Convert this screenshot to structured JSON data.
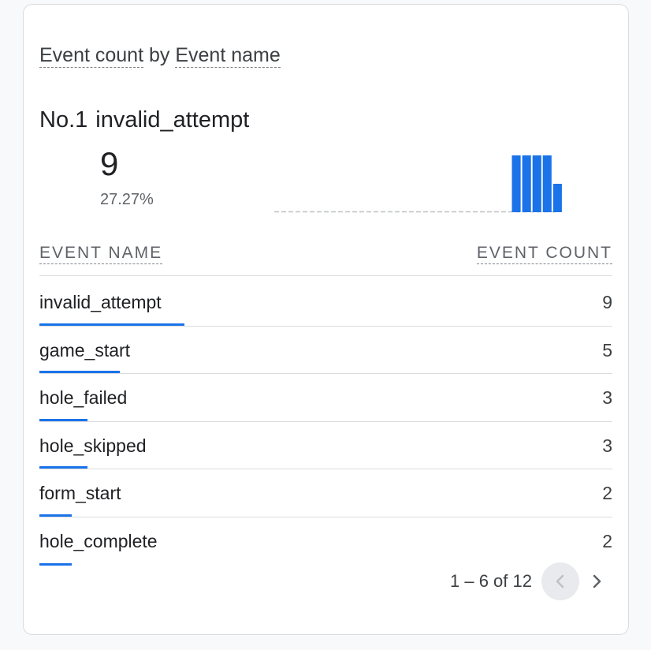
{
  "card": {
    "title_metric": "Event count",
    "title_by": "by",
    "title_dimension": "Event name"
  },
  "top_item": {
    "rank": "No.1",
    "name": "invalid_attempt",
    "value": "9",
    "percent": "27.27%",
    "sparkline_bar_levels": [
      0,
      0,
      0,
      0,
      0,
      0,
      0,
      0,
      0,
      0,
      0,
      0,
      0,
      0,
      0,
      0,
      0,
      0,
      0,
      0,
      0,
      0,
      0,
      1,
      1,
      1,
      1,
      0.5,
      0,
      0
    ]
  },
  "table": {
    "col_name": "EVENT NAME",
    "col_count": "EVENT COUNT",
    "rows": [
      {
        "name": "invalid_attempt",
        "count": "9",
        "share": 1.0
      },
      {
        "name": "game_start",
        "count": "5",
        "share": 0.556
      },
      {
        "name": "hole_failed",
        "count": "3",
        "share": 0.333
      },
      {
        "name": "hole_skipped",
        "count": "3",
        "share": 0.333
      },
      {
        "name": "form_start",
        "count": "2",
        "share": 0.222
      },
      {
        "name": "hole_complete",
        "count": "2",
        "share": 0.222
      }
    ]
  },
  "pagination": {
    "range": "1 – 6 of 12",
    "prev_icon": "chevron-left-icon",
    "next_icon": "chevron-right-icon"
  },
  "colors": {
    "accent": "#1a73e8",
    "divider": "#dadce0",
    "muted_text": "#5f6368"
  }
}
